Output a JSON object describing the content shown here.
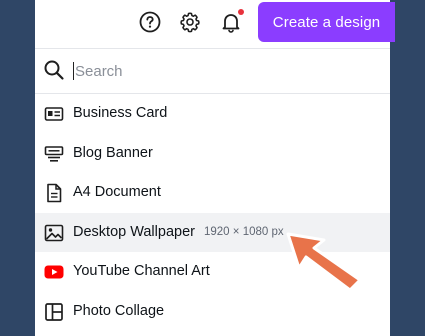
{
  "header": {
    "create_button_label": "Create a design",
    "icons": [
      "help-icon",
      "gear-icon",
      "bell-icon"
    ],
    "notification_dot_color": "#e8323c",
    "accent_color": "#8b3dff"
  },
  "search": {
    "placeholder": "Search",
    "value": ""
  },
  "menu": {
    "items": [
      {
        "label": "Business Card",
        "icon": "business-card-icon"
      },
      {
        "label": "Blog Banner",
        "icon": "blog-banner-icon"
      },
      {
        "label": "A4 Document",
        "icon": "document-icon"
      },
      {
        "label": "Desktop Wallpaper",
        "icon": "image-icon",
        "dimensions": "1920 × 1080 px",
        "highlighted": true
      },
      {
        "label": "YouTube Channel Art",
        "icon": "youtube-icon"
      },
      {
        "label": "Photo Collage",
        "icon": "collage-icon"
      }
    ]
  },
  "pointer": {
    "icon": "arrow-pointer-icon",
    "color": "#e8734a"
  }
}
